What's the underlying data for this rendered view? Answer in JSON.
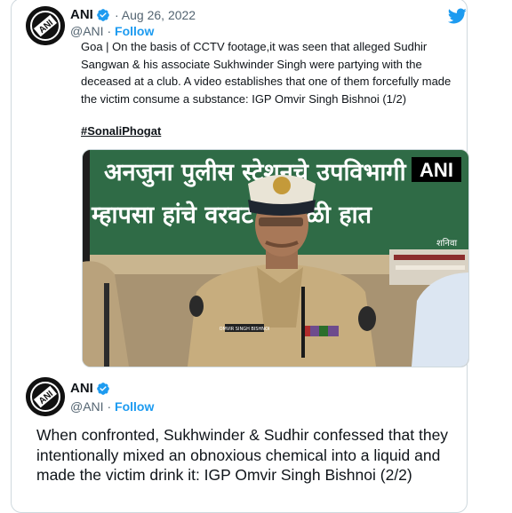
{
  "tweet1": {
    "author_name": "ANI",
    "handle": "@ANI",
    "separator": "·",
    "date": "Aug 26, 2022",
    "follow_label": "Follow",
    "text": "Goa | On the basis of CCTV footage,it was seen that alleged Sudhir Sangwan & his associate Sukhwinder Singh were partying with the deceased at a club. A video establishes that one of them forcefully made the victim consume a substance: IGP Omvir Singh Bishnoi (1/2)",
    "hashtag": "#SonaliPhogat",
    "media": {
      "banner_line1": "अनजुना पुलीस स्टेशनचे उपविभागी",
      "banner_line2": "म्हापसा हांचे वरवट कागाळी हात",
      "banner_corner": "शनिवा",
      "watermark": "ANI",
      "name_tag": "OMVIR SINGH BISHNOI"
    }
  },
  "tweet2": {
    "author_name": "ANI",
    "handle": "@ANI",
    "separator": "·",
    "follow_label": "Follow",
    "text": "When confronted, Sukhwinder & Sudhir confessed that they intentionally mixed an obnoxious chemical into a liquid and made the victim drink it: IGP Omvir Singh Bishnoi (2/2)"
  },
  "icons": {
    "verified": "verified-badge-icon",
    "twitter": "twitter-bird-icon",
    "avatar": "ani-logo"
  },
  "colors": {
    "accent": "#1d9bf0",
    "text": "#0f1419",
    "secondary": "#536471",
    "banner_green": "#2f6b46"
  }
}
